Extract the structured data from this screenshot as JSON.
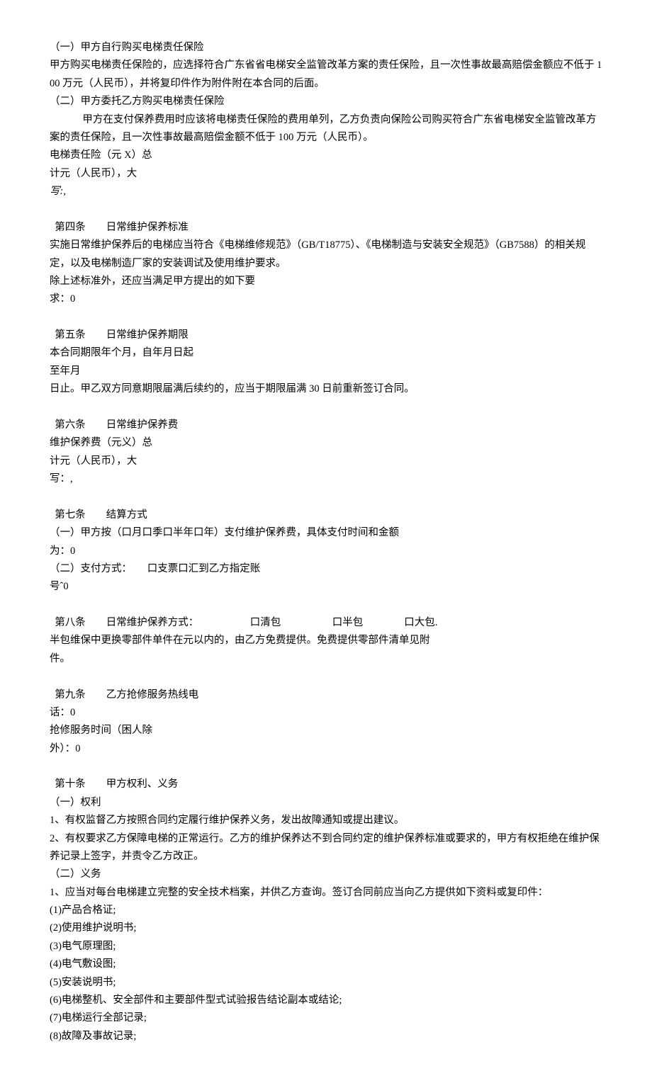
{
  "lines": {
    "l01": "（一）甲方自行购买电梯责任保险",
    "l02": "甲方购买电梯责任保险的，应选择符合广东省省电梯安全监管改革方案的责任保险，且一次性事故最高赔偿金额应不低于 100 万元（人民币），并将复印件作为附件附在本合同的后面。",
    "l03": "（二）甲方委托乙方购买电梯责任保险",
    "l04": "甲方在支付保养费用时应该将电梯责任保险的费用单列，乙方负责向保险公司购买符合广东省电梯安全监管改革方案的责任保险，且一次性事故最高赔偿金额不低于 100 万元（人民币）。",
    "l05": "电梯责任险（元 X）总",
    "l06": "计元（人民币），大",
    "l07": "写:,",
    "l08_a": "第四条",
    "l08_b": "日常维护保养标准",
    "l09": "实施日常维护保养后的电梯应当符合《电梯维修规范》（GB/T18775）、《电梯制造与安装安全规范》（GB7588）的相关规定，以及电梯制造厂家的安装调试及使用维护要求。",
    "l10": "除上述标准外，还应当满足甲方提出的如下要",
    "l11": "求：0",
    "l12_a": "第五条",
    "l12_b": "日常维护保养期限",
    "l13": "本合同期限年个月，自年月日起",
    "l14": "至年月",
    "l15": "日止。甲乙双方同意期限届满后续约的，应当于期限届满 30 日前重新签订合同。",
    "l16_a": "第六条",
    "l16_b": "日常维护保养费",
    "l17": "维护保养费（元义）总",
    "l18": "计元（人民币），大",
    "l19": "写：,",
    "l20_a": "第七条",
    "l20_b": "结算方式",
    "l21": "（一）甲方按（口月口季口半年口年）支付维护保养费，具体支付时间和金额",
    "l22": "为：0",
    "l23": "（二）支付方式：　　口支票口汇到乙方指定账",
    "l24": "号ˆ0",
    "l25_a": "第八条",
    "l25_b": "日常维护保养方式：",
    "l25_c": "口清包",
    "l25_d": "口半包",
    "l25_e": "口大包.",
    "l26": "半包维保中更换零部件单件在元以内的，由乙方免费提供。免费提供零部件清单见附",
    "l27": "件。",
    "l28_a": "第九条",
    "l28_b": "乙方抢修服务热线电",
    "l29": "话：0",
    "l30": "抢修服务时间（困人除",
    "l31": "外）：0",
    "l32_a": "第十条",
    "l32_b": "甲方权利、义务",
    "l33": "（一）权利",
    "l34": "1、有权监督乙方按照合同约定履行维护保养义务，发出故障通知或提出建议。",
    "l35": "2、有权要求乙方保障电梯的正常运行。乙方的维护保养达不到合同约定的维护保养标准或要求的，甲方有权拒绝在维护保养记录上签字，并责令乙方改正。",
    "l36": "（二）义务",
    "l37": "1、应当对每台电梯建立完整的安全技术档案，并供乙方查询。签订合同前应当向乙方提供如下资料或复印件：",
    "l38": "(1)产品合格证;",
    "l39": "(2)使用维护说明书;",
    "l40": "(3)电气原理图;",
    "l41": "(4)电气敷设图;",
    "l42": "(5)安装说明书;",
    "l43": "(6)电梯整机、安全部件和主要部件型式试验报告结论副本或结论;",
    "l44": "(7)电梯运行全部记录;",
    "l45": "(8)故障及事故记录;"
  }
}
